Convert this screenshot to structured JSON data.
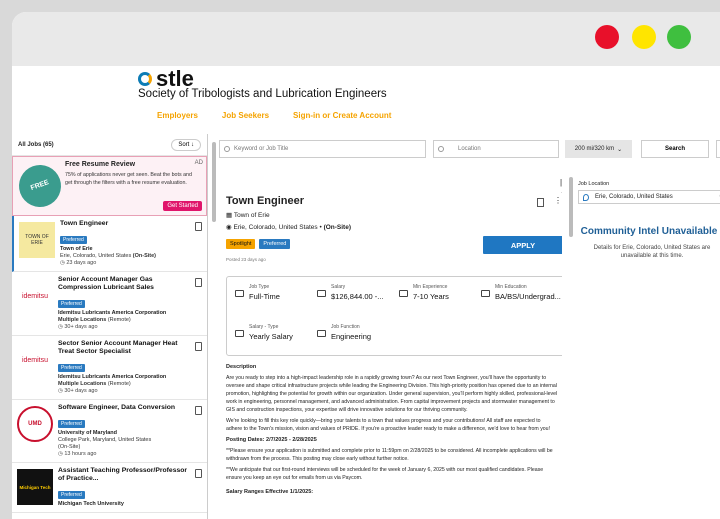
{
  "header": {
    "logo": "stle",
    "org": "Society of Tribologists and Lubrication Engineers",
    "nav": [
      "Employers",
      "Job Seekers",
      "Sign-in or Create Account"
    ]
  },
  "list": {
    "count_label": "All Jobs (65)",
    "sort_label": "Sort"
  },
  "promo": {
    "title": "Free Resume Review",
    "desc": "75% of applications never get seen. Beat the bots and get through the filters with a free resume evaluation.",
    "ad": "AD",
    "button": "Get Started",
    "badge": "FREE"
  },
  "jobs": [
    {
      "title": "Engineer",
      "co": "Town of Erie",
      "loc": "Erie, Colorado, United States",
      "tag": "(On-Site)",
      "ago": "23 days ago",
      "pref": "Preferred",
      "logo": "TOWN OF ERIE"
    },
    {
      "title": "Senior Account Manager Gas Compression Lubricant Sales",
      "co": "Idemitsu Lubricants America Corporation",
      "loc": "Multiple Locations",
      "tag": "(Remote)",
      "ago": "30+ days ago",
      "pref": "Preferred",
      "logo": "idemitsu"
    },
    {
      "title": "Sector Senior Account Manager Heat Treat Sector Specialist",
      "co": "Idemitsu Lubricants America Corporation",
      "loc": "Multiple Locations",
      "tag": "(Remote)",
      "ago": "30+ days ago",
      "pref": "Preferred",
      "logo": "idemitsu"
    },
    {
      "title": "Software Engineer, Data Conversion",
      "co": "University of Maryland",
      "loc": "College Park, Maryland, United States",
      "tag": "(On-Site)",
      "ago": "13 hours ago",
      "pref": "Preferred",
      "logo": "UMD"
    },
    {
      "title": "Assistant Teaching Professor/Professor of Practice...",
      "co": "Michigan Tech University",
      "loc": "",
      "tag": "",
      "ago": "",
      "pref": "Preferred",
      "logo": "Michigan Tech"
    }
  ],
  "search": {
    "keyword_ph": "Keyword or Job Title",
    "location_ph": "Location",
    "radius": "200 mi/320 km",
    "button": "Search"
  },
  "detail": {
    "title": "Town Engineer",
    "company": "Town of Erie",
    "location": "Erie, Colorado, United States",
    "site": "(On-Site)",
    "tags": [
      "Spotlight",
      "Preferred"
    ],
    "posted": "Posted 23 days ago",
    "apply": "APPLY",
    "facts": [
      {
        "label": "Job Type",
        "value": "Full-Time"
      },
      {
        "label": "Salary",
        "value": "$126,844.00 -..."
      },
      {
        "label": "Min Experience",
        "value": "7-10 Years"
      },
      {
        "label": "Min Education",
        "value": "BA/BS/Undergrad..."
      },
      {
        "label": "Salary - Type",
        "value": "Yearly Salary"
      },
      {
        "label": "Job Function",
        "value": "Engineering"
      }
    ],
    "desc_heading": "Description",
    "p1": "Are you ready to step into a high-impact leadership role in a rapidly growing town? As our next Town Engineer, you'll have the opportunity to oversee and shape critical infrastructure projects while leading the Engineering Division. This high-priority position has opened due to an internal promotion, highlighting the potential for growth within our organization. Under general supervision, you'll perform highly skilled, professional-level work in engineering, personnel management, and advanced administration. From capital improvement projects and stormwater management to GIS and construction inspections, your expertise will drive innovative solutions for our thriving community.",
    "p2": "We're looking to fill this key role quickly—bring your talents to a town that values progress and your contributions! All staff are expected to adhere to the Town's mission, vision and values of PRIDE. If you're a proactive leader ready to make a difference, we'd love to hear from you!",
    "dates_label": "Posting Dates: 2/7/2025 - 2/28/2025",
    "p3": "**Please ensure your application is submitted and complete prior to 11:59pm on 2/28/2025 to be considered. All incomplete applications will be withdrawn from the process. This posting may close early without further notice.",
    "p4": "**We anticipate that our first-round interviews will be scheduled for the week of January 6, 2025 with our most qualified candidates. Please ensure you keep an eye out for emails from us via Paycom.",
    "salary_heading": "Salary Ranges Effective 1/1/2025:"
  },
  "right": {
    "label": "Job Location",
    "value": "Erie, Colorado, United States",
    "count": "0",
    "ci_title": "Community Intel Unavailable",
    "ci_text": "Details for Erie, Colorado, United States are unavailable at this time."
  }
}
